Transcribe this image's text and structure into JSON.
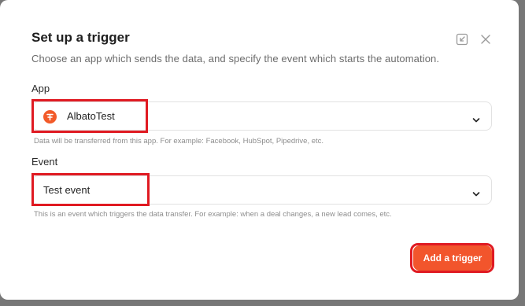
{
  "dialog": {
    "title": "Set up a trigger",
    "subtitle": "Choose an app which sends the data, and specify the event which starts the automation.",
    "collapse_icon": "collapse-icon",
    "close_icon": "close-icon"
  },
  "app_field": {
    "label": "App",
    "value": "AlbatoTest",
    "logo_icon": "albato-logo-icon",
    "hint": "Data will be transferred from this app. For example: Facebook, HubSpot, Pipedrive, etc."
  },
  "event_field": {
    "label": "Event",
    "value": "Test event",
    "hint": "This is an event which triggers the data transfer. For example: when a deal changes, a new lead comes, etc."
  },
  "actions": {
    "add_trigger_label": "Add a trigger"
  },
  "colors": {
    "accent": "#f2552c",
    "highlight": "#e01a22"
  }
}
